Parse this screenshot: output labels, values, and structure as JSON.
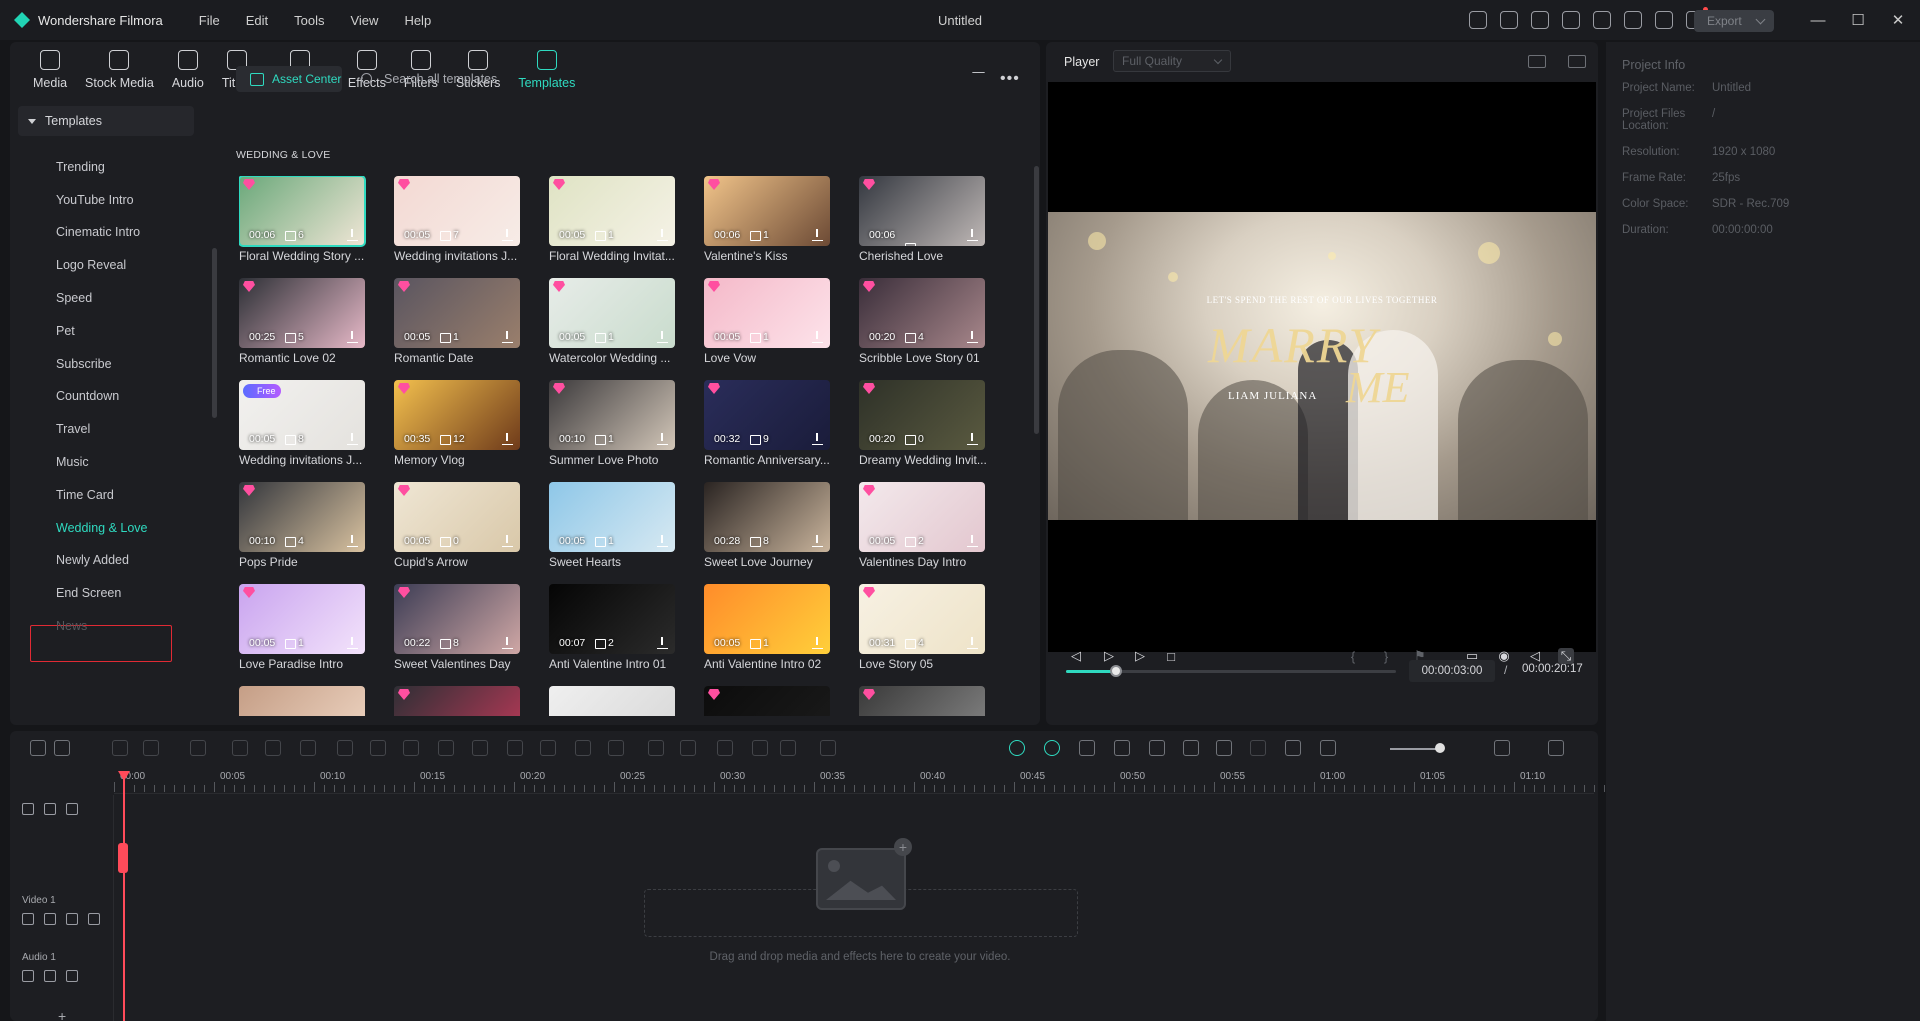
{
  "app": {
    "name": "Wondershare Filmora",
    "document_title": "Untitled",
    "accent": "#2fdac0"
  },
  "menu": [
    "File",
    "Edit",
    "Tools",
    "View",
    "Help"
  ],
  "titlebar": {
    "icons": [
      "gift-icon",
      "send-icon",
      "template-icon",
      "layout-icon",
      "save-icon",
      "cloud-upload-icon",
      "headset-icon",
      "apps-icon"
    ],
    "export_label": "Export",
    "window_controls": [
      "minimize-icon",
      "maximize-icon",
      "close-icon"
    ]
  },
  "tool_tabs": [
    {
      "label": "Media",
      "icon": "media-icon"
    },
    {
      "label": "Stock Media",
      "icon": "stock-media-icon"
    },
    {
      "label": "Audio",
      "icon": "audio-icon"
    },
    {
      "label": "Titles",
      "icon": "titles-icon"
    },
    {
      "label": "Transitions",
      "icon": "transitions-icon"
    },
    {
      "label": "Effects",
      "icon": "effects-icon"
    },
    {
      "label": "Filters",
      "icon": "filters-icon"
    },
    {
      "label": "Stickers",
      "icon": "stickers-icon"
    },
    {
      "label": "Templates",
      "icon": "templates-icon",
      "active": true
    }
  ],
  "sidebar": {
    "root": "Templates",
    "items": [
      "Trending",
      "YouTube Intro",
      "Cinematic Intro",
      "Logo Reveal",
      "Speed",
      "Pet",
      "Subscribe",
      "Countdown",
      "Travel",
      "Music",
      "Time Card",
      "Wedding & Love",
      "Newly Added",
      "End Screen",
      "News"
    ],
    "selected": "Wedding & Love"
  },
  "asset_bar": {
    "asset_center_label": "Asset Center",
    "search_placeholder": "Search all templates"
  },
  "section_title": "WEDDING & LOVE",
  "templates": [
    {
      "name": "Floral Wedding Story ...",
      "duration": "00:06",
      "clips": "6",
      "premium": true,
      "colors": [
        "#6aa87a",
        "#f0e6d6"
      ],
      "selected": true
    },
    {
      "name": "Wedding invitations J...",
      "duration": "00:05",
      "clips": "7",
      "premium": true,
      "colors": [
        "#f3d9d3",
        "#f7ece7"
      ]
    },
    {
      "name": "Floral Wedding Invitat...",
      "duration": "00:05",
      "clips": "1",
      "premium": true,
      "colors": [
        "#dfe3c4",
        "#f5f2e6"
      ]
    },
    {
      "name": "Valentine's Kiss",
      "duration": "00:06",
      "clips": "1",
      "premium": true,
      "colors": [
        "#f1c48a",
        "#6c4a35"
      ]
    },
    {
      "name": "Cherished Love",
      "duration": "00:06",
      "clips": "",
      "premium": true,
      "colors": [
        "#343840",
        "#bfb8b6"
      ]
    },
    {
      "name": "Romantic Love 02",
      "duration": "00:25",
      "clips": "5",
      "premium": true,
      "colors": [
        "#2d3036",
        "#e7b9c8"
      ]
    },
    {
      "name": "Romantic Date",
      "duration": "00:05",
      "clips": "1",
      "premium": true,
      "colors": [
        "#5a5560",
        "#9a7f6c"
      ]
    },
    {
      "name": "Watercolor Wedding ...",
      "duration": "00:05",
      "clips": "1",
      "premium": true,
      "colors": [
        "#e7ece8",
        "#c9dccd"
      ]
    },
    {
      "name": "Love Vow",
      "duration": "00:05",
      "clips": "1",
      "premium": true,
      "colors": [
        "#f4b9c9",
        "#fde3ea"
      ]
    },
    {
      "name": "Scribble Love Story 01",
      "duration": "00:20",
      "clips": "4",
      "premium": true,
      "colors": [
        "#3a2e3a",
        "#a8878b"
      ]
    },
    {
      "name": "Wedding invitations J...",
      "duration": "00:05",
      "clips": "8",
      "free": "Free",
      "colors": [
        "#f2f1ef",
        "#e4e2de"
      ]
    },
    {
      "name": "Memory Vlog",
      "duration": "00:35",
      "clips": "12",
      "premium": true,
      "colors": [
        "#f3c04e",
        "#6e3a1a"
      ]
    },
    {
      "name": "Summer Love Photo",
      "duration": "00:10",
      "clips": "1",
      "premium": true,
      "colors": [
        "#3c3a3c",
        "#d2c6b8"
      ]
    },
    {
      "name": "Romantic Anniversary...",
      "duration": "00:32",
      "clips": "9",
      "premium": true,
      "colors": [
        "#2a2d5a",
        "#1a1c3a"
      ]
    },
    {
      "name": "Dreamy Wedding Invit...",
      "duration": "00:20",
      "clips": "0",
      "premium": true,
      "colors": [
        "#2e3128",
        "#5a5a40"
      ]
    },
    {
      "name": "Pops Pride",
      "duration": "00:10",
      "clips": "4",
      "premium": true,
      "colors": [
        "#33363c",
        "#d9c2a0"
      ]
    },
    {
      "name": "Cupid's Arrow",
      "duration": "00:05",
      "clips": "0",
      "premium": true,
      "colors": [
        "#efe6d4",
        "#d9c8a9"
      ]
    },
    {
      "name": "Sweet Hearts",
      "duration": "00:05",
      "clips": "1",
      "premium": false,
      "colors": [
        "#8ec7e8",
        "#d7e9f2"
      ]
    },
    {
      "name": "Sweet Love Journey",
      "duration": "00:28",
      "clips": "8",
      "premium": false,
      "colors": [
        "#2a2422",
        "#c9b49c"
      ]
    },
    {
      "name": "Valentines Day Intro",
      "duration": "00:05",
      "clips": "2",
      "premium": true,
      "colors": [
        "#f3e9ec",
        "#e3c7cf"
      ]
    },
    {
      "name": "Love Paradise Intro",
      "duration": "00:05",
      "clips": "1",
      "premium": true,
      "colors": [
        "#c9a4ef",
        "#f3e3fb"
      ]
    },
    {
      "name": "Sweet Valentines Day",
      "duration": "00:22",
      "clips": "8",
      "premium": true,
      "colors": [
        "#3d3d55",
        "#cfa7a5"
      ]
    },
    {
      "name": "Anti Valentine Intro 01",
      "duration": "00:07",
      "clips": "2",
      "premium": false,
      "colors": [
        "#050505",
        "#2b2b2b"
      ]
    },
    {
      "name": "Anti Valentine Intro 02",
      "duration": "00:05",
      "clips": "1",
      "premium": false,
      "colors": [
        "#ff8c2a",
        "#ffcf3a"
      ]
    },
    {
      "name": "Love Story 05",
      "duration": "00:31",
      "clips": "4",
      "premium": true,
      "colors": [
        "#f7f1e3",
        "#eee3c8"
      ]
    },
    {
      "name": "",
      "duration": "",
      "clips": "",
      "premium": false,
      "colors": [
        "#c59e86",
        "#f0d8c6"
      ]
    },
    {
      "name": "",
      "duration": "",
      "clips": "",
      "premium": true,
      "colors": [
        "#2f2f35",
        "#c23a5a"
      ]
    },
    {
      "name": "",
      "duration": "",
      "clips": "",
      "premium": false,
      "colors": [
        "#efefef",
        "#d6d6d6"
      ]
    },
    {
      "name": "",
      "duration": "",
      "clips": "",
      "premium": true,
      "colors": [
        "#0c0c0c",
        "#1c1c1c"
      ]
    },
    {
      "name": "",
      "duration": "",
      "clips": "",
      "premium": true,
      "colors": [
        "#3a3a3a",
        "#8a8a8a"
      ]
    }
  ],
  "player": {
    "title": "Player",
    "quality": "Full Quality",
    "overline": "LET'S SPEND THE REST OF OUR LIVES TOGETHER",
    "marry": "MARRY",
    "me": "ME",
    "names": "LIAM JULIANA",
    "current_time": "00:00:03:00",
    "separator": "/",
    "total_time": "00:00:20:17",
    "progress": 0.15,
    "controls": [
      "prev-frame-icon",
      "play-back-icon",
      "play-icon",
      "stop-icon"
    ],
    "right_controls": [
      "mark-in-icon",
      "mark-out-icon",
      "marker-icon",
      "display-icon",
      "snapshot-icon",
      "volume-icon",
      "fullscreen-icon"
    ]
  },
  "project_info": {
    "title": "Project Info",
    "rows": [
      {
        "key": "Project Name:",
        "value": "Untitled"
      },
      {
        "key": "Project Files Location:",
        "value": "/"
      },
      {
        "key": "Resolution:",
        "value": "1920 x 1080"
      },
      {
        "key": "Frame Rate:",
        "value": "25fps"
      },
      {
        "key": "Color Space:",
        "value": "SDR - Rec.709"
      },
      {
        "key": "Duration:",
        "value": "00:00:00:00"
      }
    ]
  },
  "timeline": {
    "ticks": [
      "00:00",
      "00:05",
      "00:10",
      "00:15",
      "00:20",
      "00:25",
      "00:30",
      "00:35",
      "00:40",
      "00:45",
      "00:50",
      "00:55",
      "01:00",
      "01:05",
      "01:10"
    ],
    "tracks": [
      {
        "label": "Video 1"
      },
      {
        "label": "Audio 1"
      }
    ],
    "drop_text": "Drag and drop media and effects here to create your video.",
    "add_track": "+"
  }
}
